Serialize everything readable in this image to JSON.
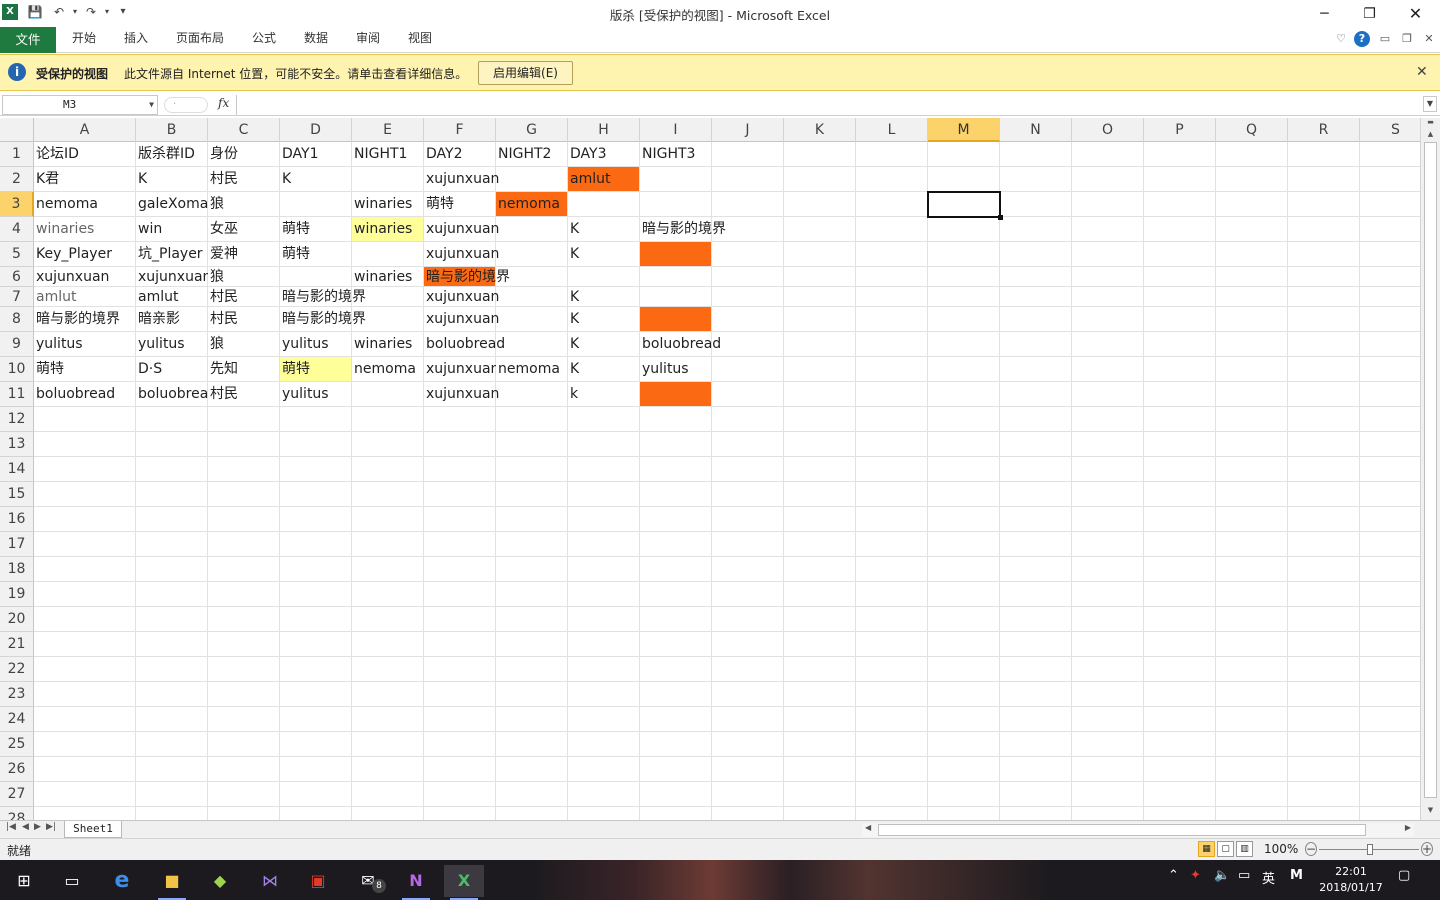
{
  "window": {
    "title": "版杀  [受保护的视图]  -  Microsoft Excel",
    "app_icon": "X"
  },
  "ribbon": {
    "file_tab": "文件",
    "tabs": [
      "开始",
      "插入",
      "页面布局",
      "公式",
      "数据",
      "审阅",
      "视图"
    ]
  },
  "protected_view": {
    "title": "受保护的视图",
    "message": "此文件源自 Internet 位置，可能不安全。请单击查看详细信息。",
    "enable_button": "启用编辑(E)"
  },
  "formula_bar": {
    "name_box": "M3",
    "fx_label": "fx",
    "formula": ""
  },
  "columns": [
    "A",
    "B",
    "C",
    "D",
    "E",
    "F",
    "G",
    "H",
    "I",
    "J",
    "K",
    "L",
    "M",
    "N",
    "O",
    "P",
    "Q",
    "R",
    "S"
  ],
  "selected_column": "M",
  "selected_row": 3,
  "rows": [
    {
      "n": 1,
      "cells": {
        "A": "论坛ID",
        "B": "版杀群ID",
        "C": "身份",
        "D": "DAY1",
        "E": "NIGHT1",
        "F": "DAY2",
        "G": "NIGHT2",
        "H": "DAY3",
        "I": "NIGHT3"
      }
    },
    {
      "n": 2,
      "cells": {
        "A": "K君",
        "B": "K",
        "C": "村民",
        "D": "K",
        "F": "xujunxuan",
        "H": "amlut"
      }
    },
    {
      "n": 3,
      "cells": {
        "A": "nemoma",
        "B": "galeXoma",
        "C": "狼",
        "E": "winaries",
        "F": "萌特",
        "G": "nemoma"
      }
    },
    {
      "n": 4,
      "cells": {
        "A": "winaries",
        "B": "win",
        "C": "女巫",
        "D": "萌特",
        "E": "winaries",
        "F": "xujunxuan",
        "H": "K",
        "I": "暗与影的境界"
      }
    },
    {
      "n": 5,
      "cells": {
        "A": "Key_Player",
        "B": "坑_Player",
        "C": "爱神",
        "D": "萌特",
        "F": "xujunxuan",
        "H": "K"
      }
    },
    {
      "n": 6,
      "cells": {
        "A": "xujunxuan",
        "B": "xujunxuan",
        "C": "狼",
        "E": "winaries",
        "F": "暗与影的境界"
      }
    },
    {
      "n": 7,
      "cells": {
        "A": "amlut",
        "B": "amlut",
        "C": "村民",
        "D": "暗与影的境界",
        "F": "xujunxuan",
        "H": "K"
      }
    },
    {
      "n": 8,
      "cells": {
        "A": "暗与影的境界",
        "B": "暗亲影",
        "C": "村民",
        "D": "暗与影的境界",
        "F": "xujunxuan",
        "H": "K"
      }
    },
    {
      "n": 9,
      "cells": {
        "A": "yulitus",
        "B": "yulitus",
        "C": "狼",
        "D": "yulitus",
        "E": "winaries",
        "F": "boluobread",
        "H": "K",
        "I": "boluobread"
      }
    },
    {
      "n": 10,
      "cells": {
        "A": "萌特",
        "B": "D·S",
        "C": "先知",
        "D": "萌特",
        "E": "nemoma",
        "F": "xujunxuan",
        "G": "nemoma",
        "H": "K",
        "I": "yulitus"
      }
    },
    {
      "n": 11,
      "cells": {
        "A": "boluobread",
        "B": "boluobread",
        "C": "村民",
        "D": "yulitus",
        "F": "xujunxuan",
        "H": "k"
      }
    }
  ],
  "empty_rows": [
    12,
    13,
    14,
    15,
    16,
    17,
    18,
    19,
    20,
    21,
    22,
    23,
    24,
    25,
    26,
    27,
    28
  ],
  "fills": [
    {
      "ref": "H2",
      "color": "#fb6a12"
    },
    {
      "ref": "G3",
      "color": "#fb6a12"
    },
    {
      "ref": "E4",
      "color": "#ffff99"
    },
    {
      "ref": "I5",
      "color": "#fb6a12"
    },
    {
      "ref": "F6",
      "color": "#fb6a12"
    },
    {
      "ref": "I8",
      "color": "#fb6a12"
    },
    {
      "ref": "D10",
      "color": "#ffff99"
    },
    {
      "ref": "I11",
      "color": "#fb6a12"
    }
  ],
  "gray_text_cells": [
    "A4",
    "A7"
  ],
  "sheet": {
    "nav": [
      "|◀",
      "◀",
      "▶",
      "▶|"
    ],
    "tab": "Sheet1"
  },
  "status": {
    "ready": "就绪",
    "zoom": "100%"
  },
  "taskbar": {
    "badge_count": "8",
    "ime": "英",
    "time": "22:01",
    "date": "2018/01/17"
  }
}
